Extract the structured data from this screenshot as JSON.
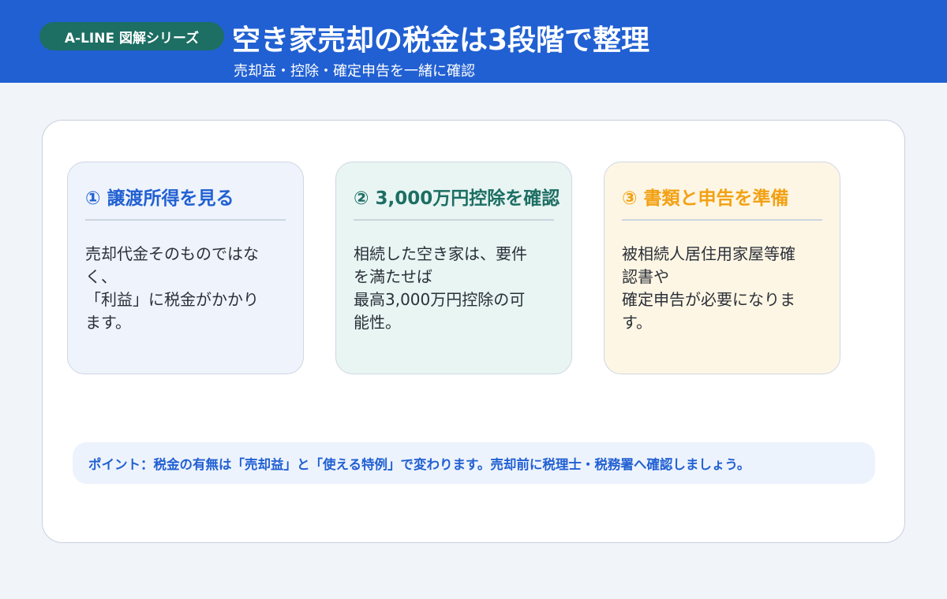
{
  "header": {
    "series_badge": "A-LINE 図解シリーズ",
    "title": "空き家売却の税金は3段階で整理",
    "subtitle": "売却益・控除・確定申告を一緒に確認"
  },
  "cards": [
    {
      "title": "① 譲渡所得を見る",
      "lines": [
        "売却代金そのものではな",
        "く、",
        "「利益」に税金がかかり",
        "ます。"
      ]
    },
    {
      "title": "② 3,000万円控除を確認",
      "lines": [
        "相続した空き家は、要件",
        "を満たせば",
        "最高3,000万円控除の可",
        "能性。"
      ]
    },
    {
      "title": "③ 書類と申告を準備",
      "lines": [
        "被相続人居住用家屋等確",
        "認書や",
        "確定申告が必要になりま",
        "す。"
      ]
    }
  ],
  "point": {
    "text": "ポイント：税金の有無は「売却益」と「使える特例」で変わります。売却前に税理士・税務署へ確認しましょう。"
  },
  "colors": {
    "header_blue": "#2160d2",
    "badge_green": "#1d6e63",
    "card1_title": "#2160d2",
    "card2_title": "#1d6e63",
    "card3_title": "#f2a114"
  }
}
